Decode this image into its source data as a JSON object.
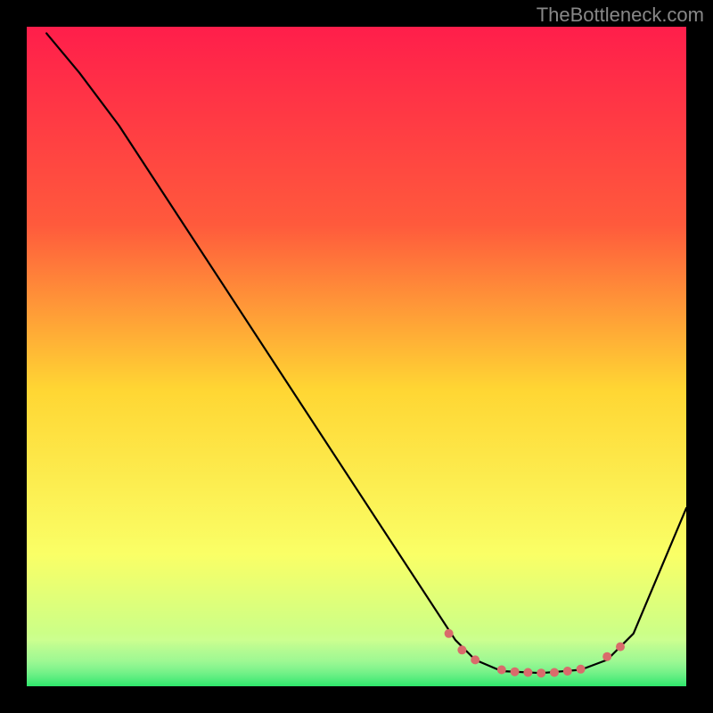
{
  "watermark": "TheBottleneck.com",
  "chart_data": {
    "type": "line",
    "title": "",
    "xlabel": "",
    "ylabel": "",
    "xlim": [
      0,
      100
    ],
    "ylim": [
      0,
      100
    ],
    "background_gradient": {
      "top": "#FF1E4B",
      "mid_upper": "#FF7A3A",
      "mid": "#FFD633",
      "mid_lower": "#FAFF66",
      "bottom": "#2EE66B"
    },
    "curve": {
      "color": "#000000",
      "width": 2.2,
      "points": [
        {
          "x": 3,
          "y": 99
        },
        {
          "x": 8,
          "y": 93
        },
        {
          "x": 14,
          "y": 85
        },
        {
          "x": 65,
          "y": 7
        },
        {
          "x": 68,
          "y": 4
        },
        {
          "x": 72,
          "y": 2.3
        },
        {
          "x": 78,
          "y": 2
        },
        {
          "x": 84,
          "y": 2.5
        },
        {
          "x": 88,
          "y": 4
        },
        {
          "x": 92,
          "y": 8
        },
        {
          "x": 100,
          "y": 27
        }
      ]
    },
    "markers": {
      "color": "#D96B6B",
      "radius": 5,
      "points": [
        {
          "x": 64,
          "y": 8
        },
        {
          "x": 66,
          "y": 5.5
        },
        {
          "x": 68,
          "y": 4
        },
        {
          "x": 72,
          "y": 2.5
        },
        {
          "x": 74,
          "y": 2.2
        },
        {
          "x": 76,
          "y": 2.1
        },
        {
          "x": 78,
          "y": 2
        },
        {
          "x": 80,
          "y": 2.1
        },
        {
          "x": 82,
          "y": 2.3
        },
        {
          "x": 84,
          "y": 2.6
        },
        {
          "x": 88,
          "y": 4.5
        },
        {
          "x": 90,
          "y": 6
        }
      ]
    },
    "green_band": {
      "y0": 0,
      "y1": 5,
      "color_top": "rgba(120,255,160,0.0)",
      "color_bottom": "#2EE66B"
    }
  }
}
